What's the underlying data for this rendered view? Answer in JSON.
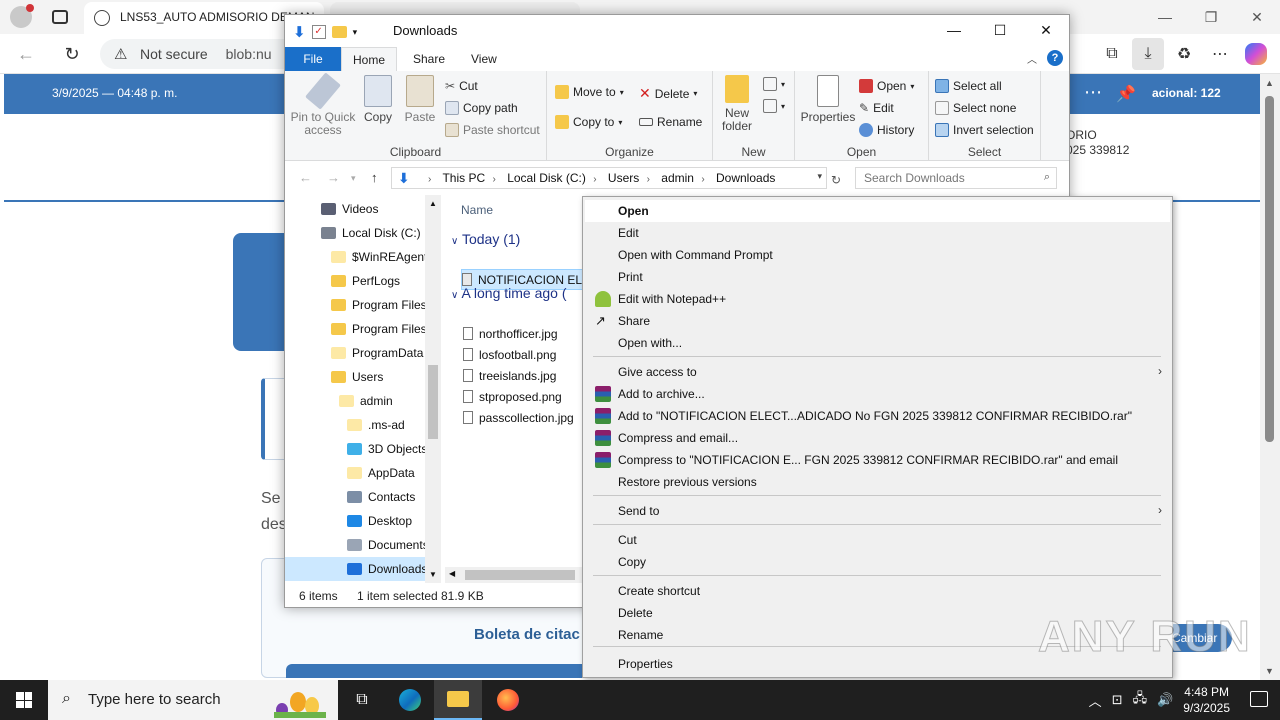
{
  "browser": {
    "tab_title": "LNS53_AUTO ADMISORIO DEMAN",
    "not_secure": "Not secure",
    "url": "blob:nu"
  },
  "web": {
    "date": "3/9/2025 — 04:48 p. m.",
    "banner_right": "acional: 122",
    "side_line1": "ORIO",
    "side_line2": "025 339812",
    "text_se": "Se",
    "text_des": "des",
    "boleta": "Boleta de citac",
    "cambiar": "Cambiar"
  },
  "explorer": {
    "title": "Downloads",
    "ribbon_tabs": {
      "file": "File",
      "home": "Home",
      "share": "Share",
      "view": "View"
    },
    "clipboard": {
      "label": "Clipboard",
      "pin": "Pin to Quick access",
      "copy": "Copy",
      "paste": "Paste",
      "cut": "Cut",
      "copy_path": "Copy path",
      "paste_shortcut": "Paste shortcut"
    },
    "organize": {
      "label": "Organize",
      "move_to": "Move to",
      "copy_to": "Copy to",
      "delete": "Delete",
      "rename": "Rename"
    },
    "new": {
      "label": "New",
      "new_folder": "New folder"
    },
    "open": {
      "label": "Open",
      "properties": "Properties",
      "open": "Open",
      "edit": "Edit",
      "history": "History"
    },
    "select": {
      "label": "Select",
      "select_all": "Select all",
      "select_none": "Select none",
      "invert": "Invert selection"
    },
    "path": [
      "This PC",
      "Local Disk (C:)",
      "Users",
      "admin",
      "Downloads"
    ],
    "search_placeholder": "Search Downloads",
    "nav": [
      {
        "label": "Videos",
        "color": "#5a5f73"
      },
      {
        "label": "Local Disk (C:)",
        "color": "#7a8290"
      },
      {
        "label": "$WinREAgent",
        "color": "#fde9a6"
      },
      {
        "label": "PerfLogs",
        "color": "#f5c84a"
      },
      {
        "label": "Program Files",
        "color": "#f5c84a"
      },
      {
        "label": "Program Files",
        "color": "#f5c84a"
      },
      {
        "label": "ProgramData",
        "color": "#fde9a6"
      },
      {
        "label": "Users",
        "color": "#f5c84a"
      },
      {
        "label": "admin",
        "color": "#fde9a6"
      },
      {
        "label": ".ms-ad",
        "color": "#fde9a6"
      },
      {
        "label": "3D Objects",
        "color": "#3fb0e8"
      },
      {
        "label": "AppData",
        "color": "#fde9a6"
      },
      {
        "label": "Contacts",
        "color": "#7c8ea6"
      },
      {
        "label": "Desktop",
        "color": "#1e88e5"
      },
      {
        "label": "Documents",
        "color": "#9aa5b5"
      },
      {
        "label": "Downloads",
        "color": "#1e6fd9"
      }
    ],
    "column_name": "Name",
    "group_today": "Today (1)",
    "group_long_ago": "A long time ago (",
    "selected_file": "NOTIFICACION ELE",
    "files": [
      "northofficer.jpg",
      "losfootball.png",
      "treeislands.jpg",
      "stproposed.png",
      "passcollection.jpg"
    ],
    "status_items": "6 items",
    "status_selected": "1 item selected",
    "status_size": "81.9 KB"
  },
  "context_menu": {
    "items": [
      {
        "label": "Open",
        "bold": true,
        "icon": "",
        "submenu": false
      },
      {
        "label": "Edit",
        "icon": "",
        "submenu": false
      },
      {
        "label": "Open with Command Prompt",
        "icon": "",
        "submenu": false
      },
      {
        "label": "Print",
        "icon": "",
        "submenu": false
      },
      {
        "label": "Edit with Notepad++",
        "icon": "notepadpp-icon",
        "submenu": false
      },
      {
        "label": "Share",
        "icon": "share-icon",
        "submenu": false
      },
      {
        "label": "Open with...",
        "icon": "",
        "submenu": false
      },
      {
        "label": "Give access to",
        "icon": "",
        "submenu": true
      },
      {
        "label": "Add to archive...",
        "icon": "winrar-icon",
        "submenu": false
      },
      {
        "label": "Add to \"NOTIFICACION ELECT...ADICADO No FGN 2025 339812 CONFIRMAR RECIBIDO.rar\"",
        "icon": "winrar-icon",
        "submenu": false
      },
      {
        "label": "Compress and email...",
        "icon": "winrar-icon",
        "submenu": false
      },
      {
        "label": "Compress to \"NOTIFICACION E... FGN 2025 339812 CONFIRMAR RECIBIDO.rar\" and email",
        "icon": "winrar-icon",
        "submenu": false
      },
      {
        "label": "Restore previous versions",
        "icon": "",
        "submenu": false
      },
      {
        "label": "Send to",
        "icon": "",
        "submenu": true
      },
      {
        "label": "Cut",
        "icon": "",
        "submenu": false
      },
      {
        "label": "Copy",
        "icon": "",
        "submenu": false
      },
      {
        "label": "Create shortcut",
        "icon": "",
        "submenu": false
      },
      {
        "label": "Delete",
        "icon": "",
        "submenu": false
      },
      {
        "label": "Rename",
        "icon": "",
        "submenu": false
      },
      {
        "label": "Properties",
        "icon": "",
        "submenu": false
      }
    ]
  },
  "taskbar": {
    "search_placeholder": "Type here to search",
    "time": "4:48 PM",
    "date": "9/3/2025"
  },
  "watermark": "ANY RUN",
  "colors": {
    "accent": "#1a6fc9",
    "web_banner": "#3a75b7",
    "selection": "#cce8ff"
  }
}
